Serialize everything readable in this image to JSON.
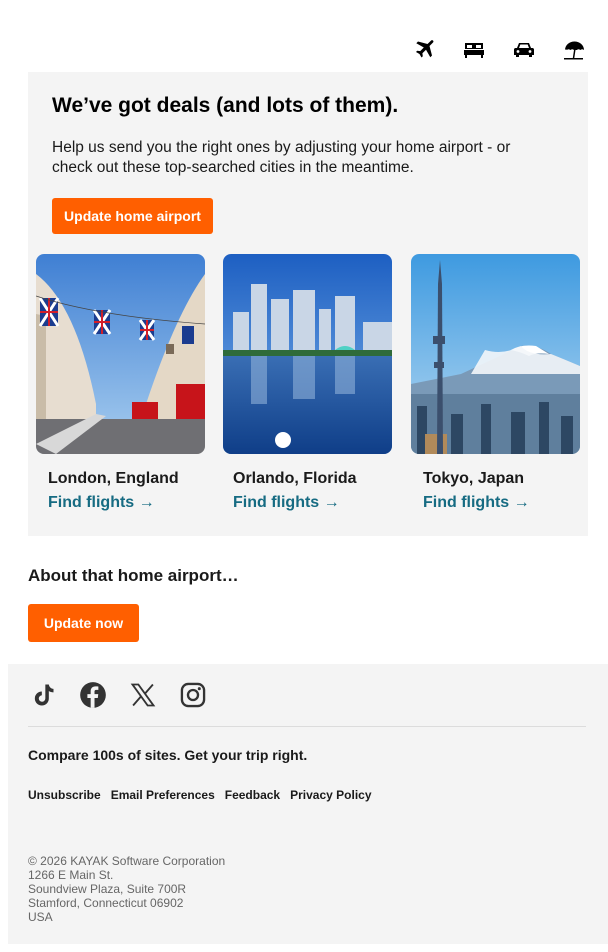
{
  "nav": {
    "icons": [
      "plane-icon",
      "bed-icon",
      "car-icon",
      "beach-umbrella-icon"
    ]
  },
  "hero": {
    "title": "We’ve got deals (and lots of them).",
    "body": "Help us send you the right ones by adjusting your home airport - or check out these top-searched cities in the meantime.",
    "button_label": "Update home airport"
  },
  "cards": [
    {
      "city": "London, England",
      "link": "Find flights →"
    },
    {
      "city": "Orlando, Florida",
      "link": "Find flights →"
    },
    {
      "city": "Tokyo, Japan",
      "link": "Find flights →"
    }
  ],
  "about": {
    "heading": "About that home airport…",
    "button_label": "Update now"
  },
  "footer": {
    "social": [
      "tiktok-icon",
      "facebook-icon",
      "x-icon",
      "instagram-icon"
    ],
    "tagline": "Compare 100s of sites. Get your trip right.",
    "links": [
      "Unsubscribe",
      "Email Preferences",
      "Feedback",
      "Privacy Policy"
    ],
    "address": [
      "© 2026 KAYAK Software Corporation",
      "1266 E Main St.",
      "Soundview Plaza, Suite 700R",
      "Stamford, Connecticut 06902",
      "USA"
    ]
  },
  "colors": {
    "accent": "#ff5f00",
    "link": "#166b82",
    "panel": "#f4f4f4"
  }
}
